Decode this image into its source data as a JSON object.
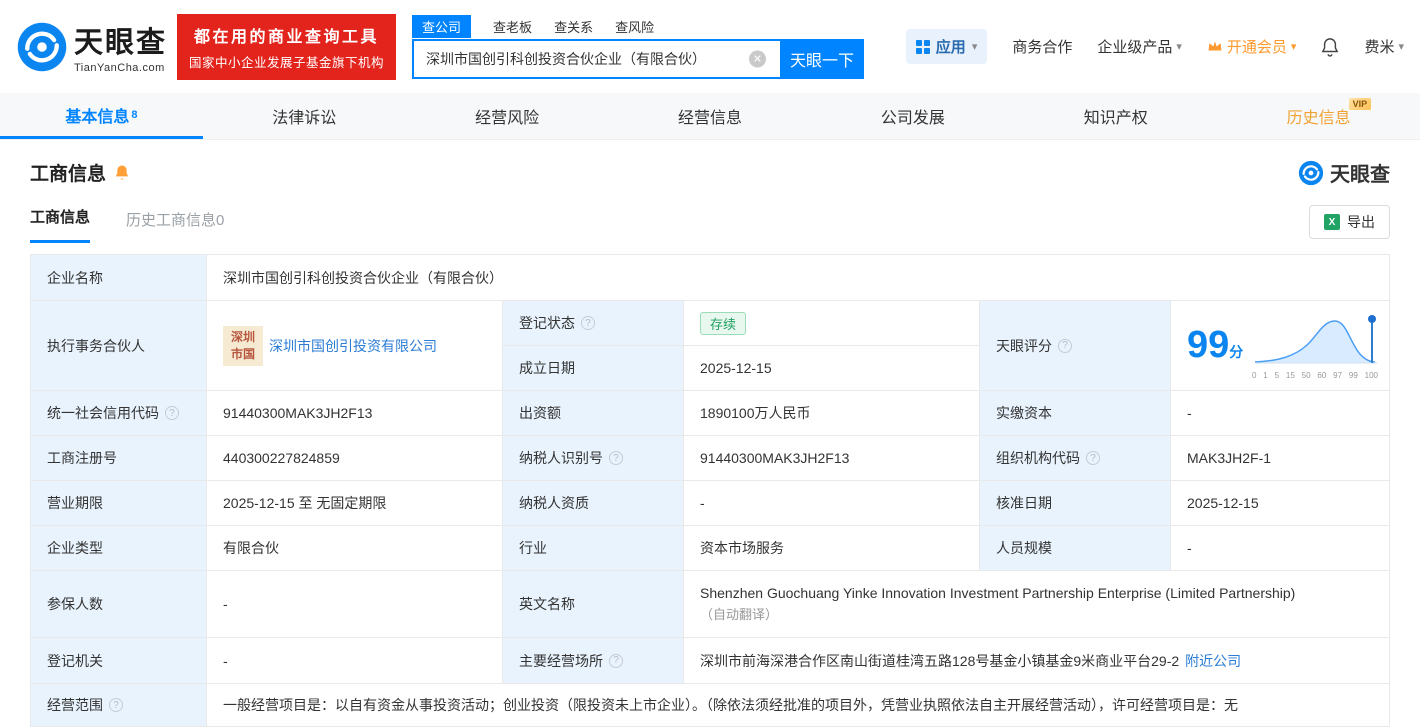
{
  "brand": {
    "name": "天眼查",
    "domain": "TianYanCha.com",
    "slogan1": "都在用的商业查询工具",
    "slogan2": "国家中小企业发展子基金旗下机构",
    "accent_color": "#0084ff",
    "red_color": "#e2241d"
  },
  "icons": {
    "chevron_down": "▾",
    "clear": "✕",
    "help": "?",
    "excel": "X"
  },
  "search": {
    "tabs": [
      {
        "label": "查公司",
        "active": true
      },
      {
        "label": "查老板",
        "active": false
      },
      {
        "label": "查关系",
        "active": false
      },
      {
        "label": "查风险",
        "active": false
      }
    ],
    "value": "深圳市国创引科创投资合伙企业（有限合伙）",
    "button": "天眼一下"
  },
  "topnav": {
    "apps": "应用",
    "business": "商务合作",
    "enterprise": "企业级产品",
    "vip": "开通会员",
    "user": "费米"
  },
  "tabs": [
    {
      "label": "基本信息",
      "count": "8"
    },
    {
      "label": "法律诉讼"
    },
    {
      "label": "经营风险"
    },
    {
      "label": "经营信息"
    },
    {
      "label": "公司发展"
    },
    {
      "label": "知识产权"
    },
    {
      "label": "历史信息",
      "vip": "VIP"
    }
  ],
  "section": {
    "title": "工商信息",
    "watermark": "天眼查",
    "subtab_active": "工商信息",
    "subtab_history": "历史工商信息0",
    "export": "导出"
  },
  "biz": {
    "name_label": "企业名称",
    "name": "深圳市国创引科创投资合伙企业（有限合伙）",
    "partner_label": "执行事务合伙人",
    "partner_logo_line1": "深圳",
    "partner_logo_line2": "市国",
    "partner": "深圳市国创引投资有限公司",
    "status_label": "登记状态",
    "status": "存续",
    "founded_label": "成立日期",
    "founded": "2025-12-15",
    "score_label": "天眼评分",
    "score": "99",
    "score_unit": "分",
    "score_ticks": [
      "0",
      "1",
      "5",
      "15",
      "50",
      "60",
      "97",
      "99",
      "100"
    ],
    "credit_code_label": "统一社会信用代码",
    "credit_code": "91440300MAK3JH2F13",
    "capital_label": "出资额",
    "capital": "1890100万人民币",
    "paid_capital_label": "实缴资本",
    "paid_capital": "-",
    "reg_no_label": "工商注册号",
    "reg_no": "440300227824859",
    "tax_id_label": "纳税人识别号",
    "tax_id": "91440300MAK3JH2F13",
    "org_code_label": "组织机构代码",
    "org_code": "MAK3JH2F-1",
    "term_label": "营业期限",
    "term": "2025-12-15 至 无固定期限",
    "tax_qual_label": "纳税人资质",
    "tax_qual": "-",
    "approval_date_label": "核准日期",
    "approval_date": "2025-12-15",
    "type_label": "企业类型",
    "type": "有限合伙",
    "industry_label": "行业",
    "industry": "资本市场服务",
    "staff_label": "人员规模",
    "staff": "-",
    "insured_label": "参保人数",
    "insured": "-",
    "en_name_label": "英文名称",
    "en_name": "Shenzhen Guochuang Yinke Innovation Investment Partnership Enterprise (Limited Partnership)",
    "en_name_note": "（自动翻译）",
    "authority_label": "登记机关",
    "authority": "-",
    "address_label": "主要经营场所",
    "address": "深圳市前海深港合作区南山街道桂湾五路128号基金小镇基金9米商业平台29-2",
    "nearby_link": "附近公司",
    "scope_label": "经营范围",
    "scope": "一般经营项目是：以自有资金从事投资活动；创业投资（限投资未上市企业）。（除依法须经批准的项目外，凭营业执照依法自主开展经营活动），许可经营项目是：无"
  }
}
